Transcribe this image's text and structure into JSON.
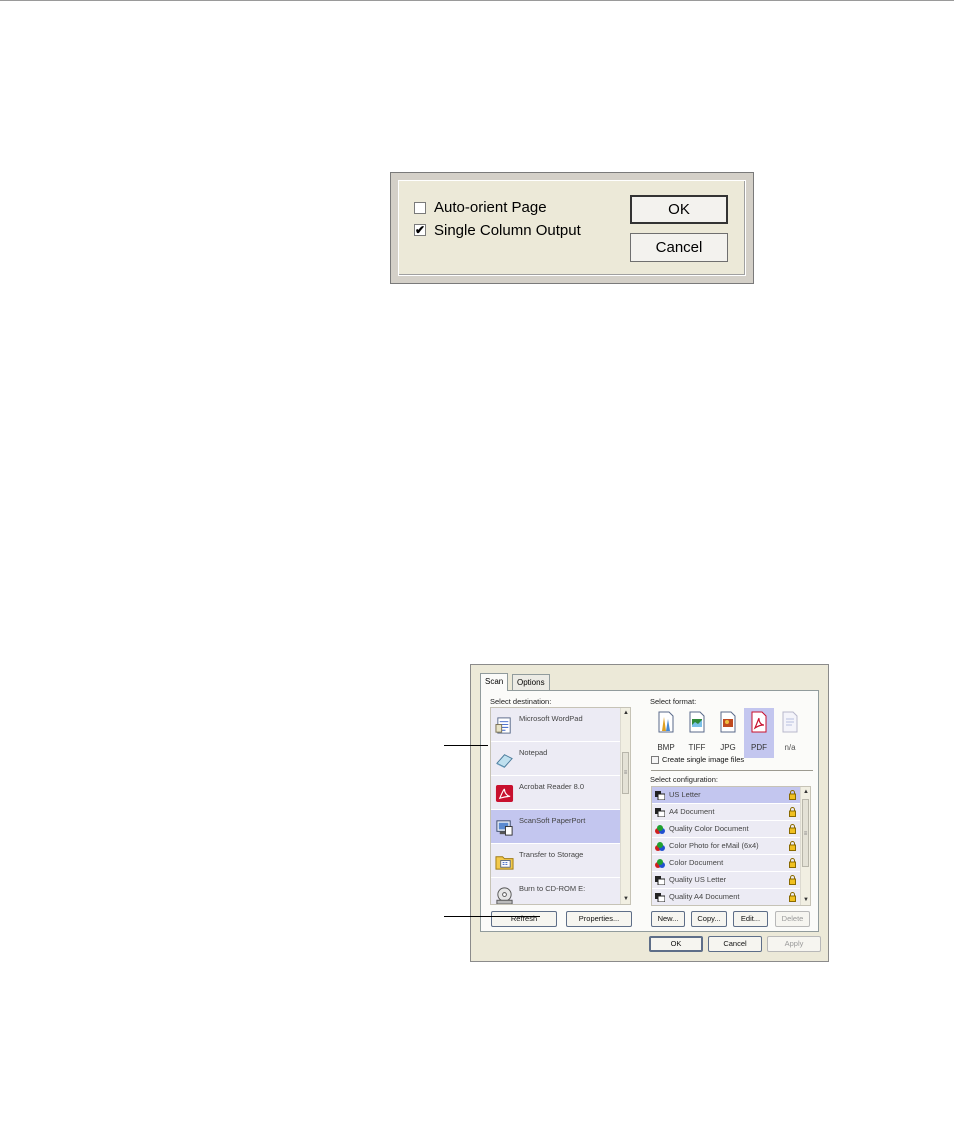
{
  "options_dialog": {
    "auto_orient_label": "Auto-orient Page",
    "auto_orient_checked": false,
    "single_column_label": "Single Column Output",
    "single_column_checked": true,
    "ok_label": "OK",
    "cancel_label": "Cancel",
    "check_mark": "✔"
  },
  "scan_dialog": {
    "tabs": [
      {
        "label": "Scan",
        "active": true
      },
      {
        "label": "Options",
        "active": false
      }
    ],
    "select_destination_label": "Select destination:",
    "destinations": [
      {
        "label": "Microsoft WordPad",
        "icon": "wordpad-icon"
      },
      {
        "label": "Notepad",
        "icon": "notepad-icon"
      },
      {
        "label": "Acrobat Reader 8.0",
        "icon": "acrobat-icon"
      },
      {
        "label": "ScanSoft PaperPort",
        "icon": "paperport-icon",
        "selected": true
      },
      {
        "label": "Transfer to Storage",
        "icon": "storage-folder-icon"
      },
      {
        "label": "Burn to CD-ROM  E:",
        "icon": "cd-rom-icon"
      }
    ],
    "select_format_label": "Select format:",
    "formats": [
      {
        "label": "BMP",
        "icon": "bmp-icon"
      },
      {
        "label": "TIFF",
        "icon": "tiff-icon"
      },
      {
        "label": "JPG",
        "icon": "jpg-icon"
      },
      {
        "label": "PDF",
        "icon": "pdf-icon",
        "selected": true
      },
      {
        "label": "n/a",
        "icon": "na-icon"
      }
    ],
    "create_single_label": "Create single image files",
    "select_configuration_label": "Select configuration:",
    "configurations": [
      {
        "label": "US Letter",
        "icon": "bw-page-icon",
        "selected": true
      },
      {
        "label": "A4 Document",
        "icon": "bw-page-icon"
      },
      {
        "label": "Quality Color Document",
        "icon": "color-icon"
      },
      {
        "label": "Color Photo for eMail (6x4)",
        "icon": "color-icon"
      },
      {
        "label": "Color Document",
        "icon": "color-icon"
      },
      {
        "label": "Quality US Letter",
        "icon": "bw-page-icon"
      },
      {
        "label": "Quality A4 Document",
        "icon": "bw-page-icon"
      }
    ],
    "buttons": {
      "refresh": "Refresh",
      "properties": "Properties...",
      "new": "New...",
      "copy": "Copy...",
      "edit": "Edit...",
      "delete": "Delete",
      "ok": "OK",
      "cancel": "Cancel",
      "apply": "Apply"
    },
    "scroll_up": "▲",
    "scroll_down": "▼",
    "scroll_grip": "≡"
  },
  "colors": {
    "selection": "#c3c6ef",
    "list_bg": "#ecebf4",
    "dialog_bg": "#ece9d8"
  }
}
